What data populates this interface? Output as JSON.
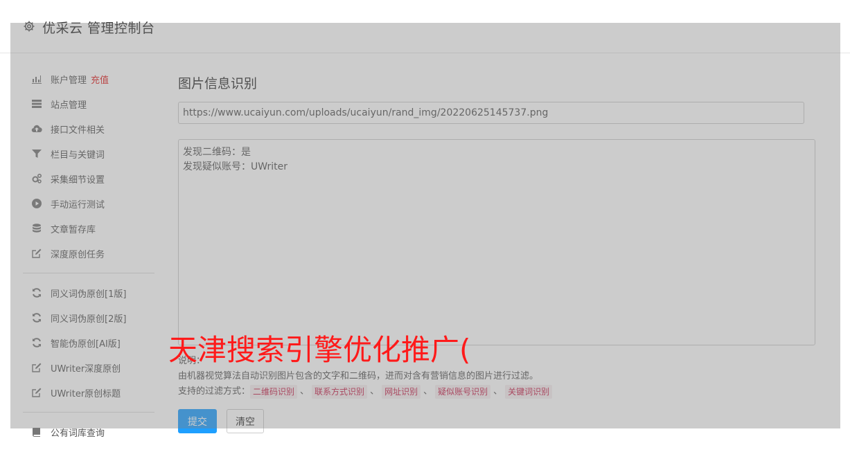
{
  "header": {
    "title": "优采云 管理控制台",
    "icon": "gear-icon"
  },
  "sidebar": {
    "groups": [
      [
        {
          "icon": "bar-chart-icon",
          "label": "账户管理",
          "extra": "充值"
        },
        {
          "icon": "server-icon",
          "label": "站点管理"
        },
        {
          "icon": "cloud-upload-icon",
          "label": "接口文件相关"
        },
        {
          "icon": "filter-icon",
          "label": "栏目与关键词"
        },
        {
          "icon": "gears-icon",
          "label": "采集细节设置"
        },
        {
          "icon": "play-circle-icon",
          "label": "手动运行测试"
        },
        {
          "icon": "database-icon",
          "label": "文章暂存库"
        },
        {
          "icon": "edit-icon",
          "label": "深度原创任务"
        }
      ],
      [
        {
          "icon": "refresh-icon",
          "label": "同义词伪原创[1版]"
        },
        {
          "icon": "refresh-icon",
          "label": "同义词伪原创[2版]"
        },
        {
          "icon": "refresh-icon",
          "label": "智能伪原创[AI版]"
        },
        {
          "icon": "edit-icon",
          "label": "UWriter深度原创"
        },
        {
          "icon": "edit-icon",
          "label": "UWriter原创标题"
        }
      ],
      [
        {
          "icon": "book-icon",
          "label": "公有词库查询"
        }
      ]
    ]
  },
  "main": {
    "heading": "图片信息识别",
    "url_value": "https://www.ucaiyun.com/uploads/ucaiyun/rand_img/20220625145737.png",
    "result_lines": [
      "发现二维码：是",
      "发现疑似账号：UWriter"
    ],
    "notes": {
      "label": "说明：",
      "description": "由机器视觉算法自动识别图片包含的文字和二维码，进而对含有营销信息的图片进行过滤。",
      "filters_label": "支持的过滤方式：",
      "filters": [
        "二维码识别",
        "联系方式识别",
        "网址识别",
        "疑似账号识别",
        "关键词识别"
      ],
      "separator": "、"
    },
    "buttons": {
      "submit": "提交",
      "clear": "清空"
    }
  },
  "watermark": "天津搜索引擎优化推广(",
  "colors": {
    "accent": "#1e9fff",
    "highlight": "#e02020",
    "watermark": "#ff1a1a",
    "tag_text": "#c7254e"
  }
}
